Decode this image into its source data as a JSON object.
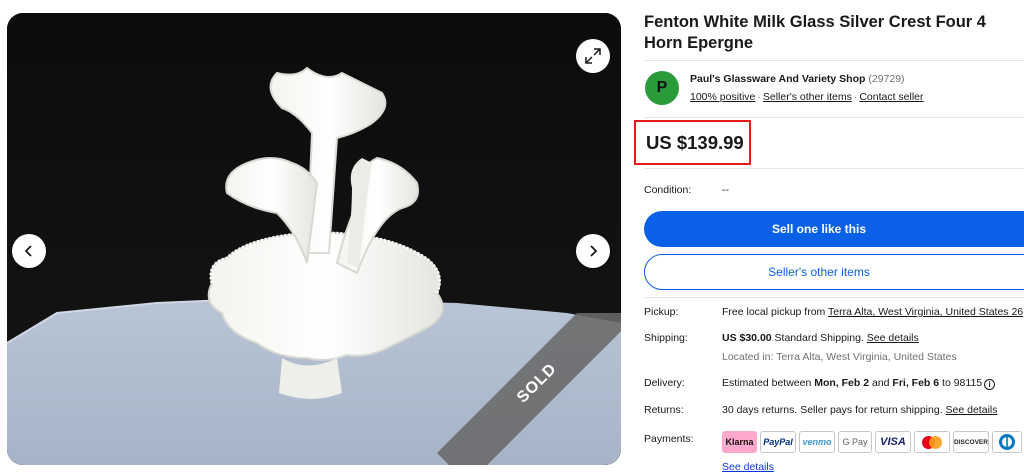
{
  "gallery": {
    "sold_label": "SOLD",
    "icons": {
      "prev": "chevron-left-icon",
      "next": "chevron-right-icon",
      "expand": "expand-icon"
    }
  },
  "listing": {
    "title": "Fenton White Milk Glass Silver Crest Four 4 Horn Epergne"
  },
  "seller": {
    "avatar_letter": "P",
    "avatar_color": "#2a9a3a",
    "name": "Paul's Glassware And Variety Shop",
    "feedback_count": "(29729)",
    "positive": "100% positive",
    "other_items": "Seller's other items",
    "contact": "Contact seller"
  },
  "price": {
    "value": "US $139.99",
    "highlight_color": "#e31b1b"
  },
  "condition": {
    "label": "Condition:",
    "value": "--"
  },
  "buttons": {
    "sell_like_this": "Sell one like this",
    "sellers_other_items": "Seller's other items",
    "primary_color": "#0a60e6"
  },
  "pickup": {
    "label": "Pickup:",
    "prefix": "Free local pickup from ",
    "location": "Terra Alta, West Virginia, United States 26"
  },
  "shipping": {
    "label": "Shipping:",
    "cost": "US $30.00",
    "method": " Standard Shipping. ",
    "details_link": "See details",
    "located": "Located in: Terra Alta, West Virginia, United States"
  },
  "delivery": {
    "label": "Delivery:",
    "prefix": "Estimated between ",
    "start": "Mon, Feb 2",
    "and": " and ",
    "end": "Fri, Feb 6",
    "suffix": " to 98115"
  },
  "returns": {
    "label": "Returns:",
    "text": "30 days returns. Seller pays for return shipping. ",
    "details_link": "See details"
  },
  "payments": {
    "label": "Payments:",
    "methods": [
      "Klarna",
      "PayPal",
      "venmo",
      "G Pay",
      "VISA",
      "Mastercard",
      "DISCOVER",
      "Diners Club"
    ],
    "details_link": "See details"
  }
}
